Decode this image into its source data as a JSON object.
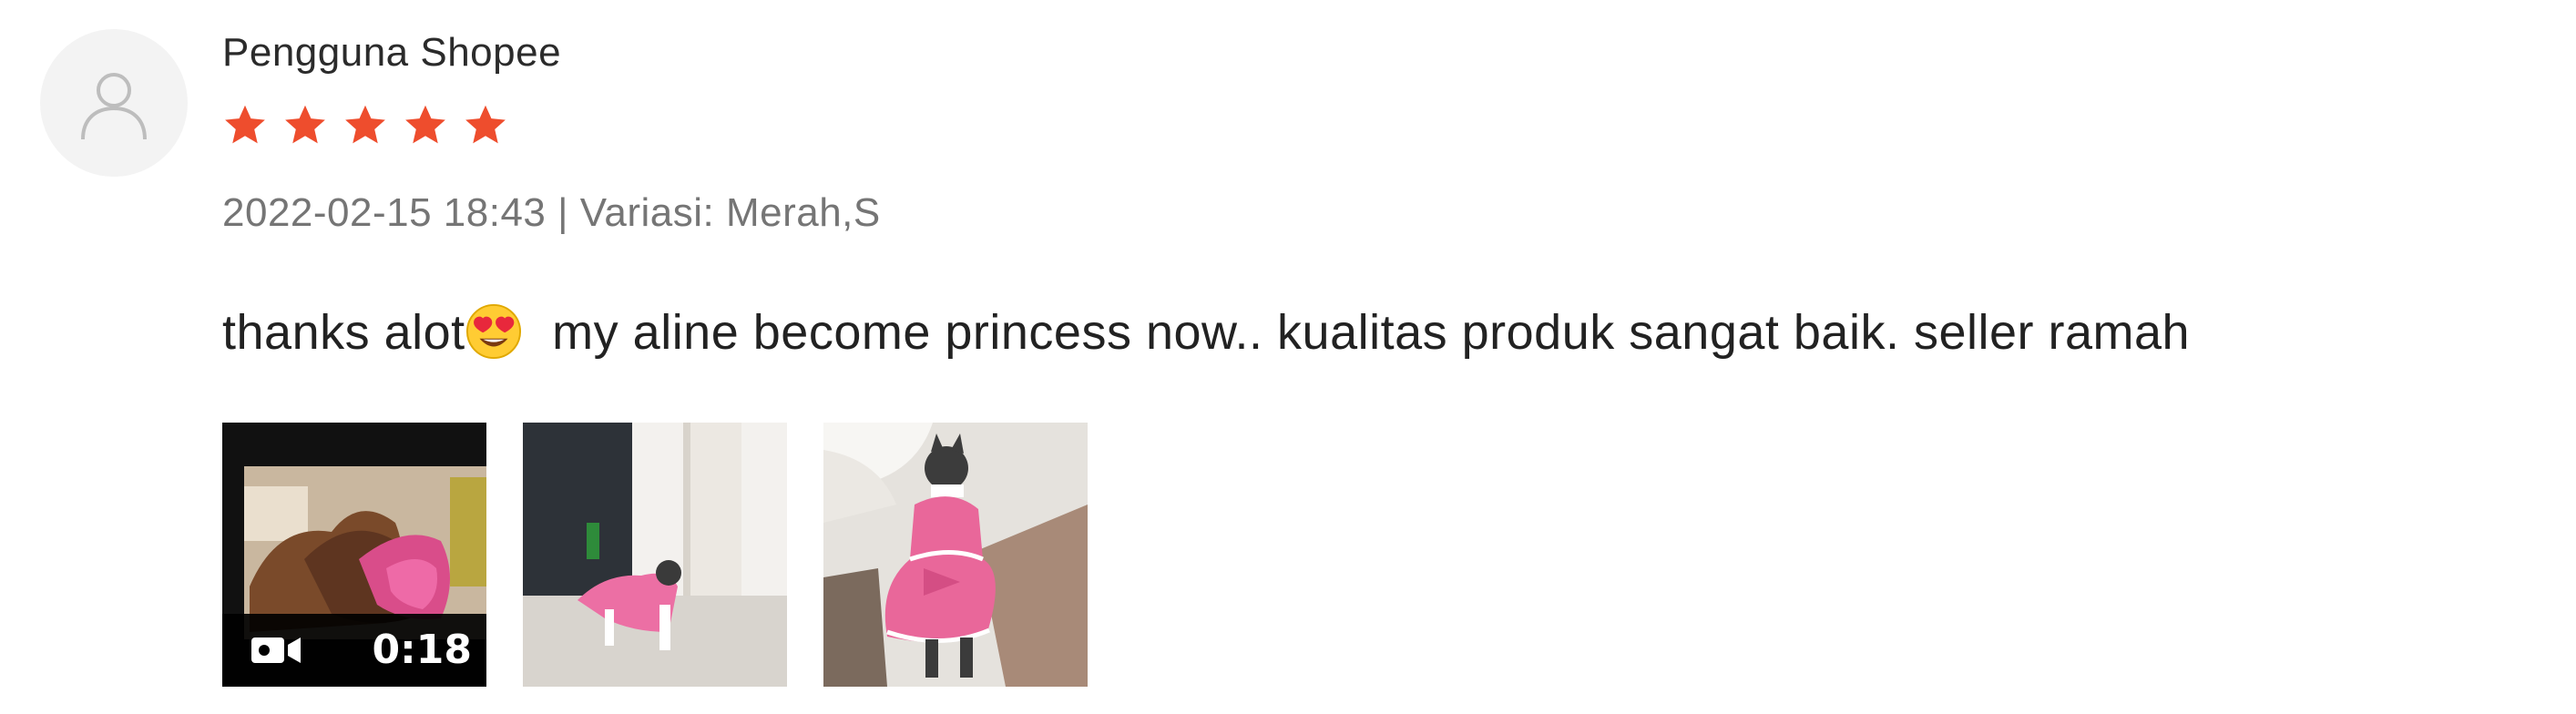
{
  "review": {
    "username": "Pengguna Shopee",
    "rating": 5,
    "rating_max": 5,
    "meta": "2022-02-15 18:43 | Variasi: Merah,S",
    "comment_before_emoji": "thanks alot",
    "emoji_icon": "heart-eyes-emoji",
    "comment_after_emoji": " my aline become princess now..  kualitas produk sangat baik.  seller ramah",
    "media": [
      {
        "type": "video",
        "duration": "0:18"
      },
      {
        "type": "image"
      },
      {
        "type": "image"
      }
    ]
  },
  "colors": {
    "star": "#ee4d2d",
    "avatar_bg": "#f3f3f3",
    "meta_text": "#757575"
  }
}
